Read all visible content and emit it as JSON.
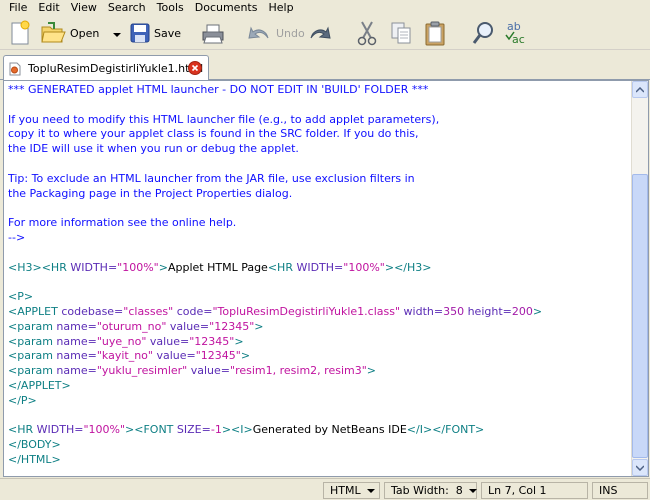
{
  "menu": [
    "File",
    "Edit",
    "View",
    "Search",
    "Tools",
    "Documents",
    "Help"
  ],
  "toolbar": {
    "open_label": "Open",
    "save_label": "Save",
    "undo_label": "Undo"
  },
  "tab": {
    "label": "TopluResimDegistirliYukle1.html"
  },
  "code_lines": [
    [
      {
        "c": "c-comment",
        "t": "*** GENERATED applet HTML launcher - DO NOT EDIT IN 'BUILD' FOLDER ***"
      }
    ],
    [],
    [
      {
        "c": "c-comment",
        "t": "If you need to modify this HTML launcher file (e.g., to add applet parameters),"
      }
    ],
    [
      {
        "c": "c-comment",
        "t": "copy it to where your applet class is found in the SRC folder. If you do this,"
      }
    ],
    [
      {
        "c": "c-comment",
        "t": "the IDE will use it when you run or debug the applet."
      }
    ],
    [],
    [
      {
        "c": "c-comment",
        "t": "Tip: To exclude an HTML launcher from the JAR file, use exclusion filters in"
      }
    ],
    [
      {
        "c": "c-comment",
        "t": "the Packaging page in the Project Properties dialog."
      }
    ],
    [],
    [
      {
        "c": "c-comment",
        "t": "For more information see the online help."
      }
    ],
    [
      {
        "c": "c-comment",
        "t": "-->"
      }
    ],
    [],
    [
      {
        "c": "c-tag",
        "t": "<H3>"
      },
      {
        "c": "c-tag",
        "t": "<HR "
      },
      {
        "c": "c-attr",
        "t": "WIDTH="
      },
      {
        "c": "c-val",
        "t": "\"100%\""
      },
      {
        "c": "c-tag",
        "t": ">"
      },
      {
        "c": "c-text",
        "t": "Applet HTML Page"
      },
      {
        "c": "c-tag",
        "t": "<HR "
      },
      {
        "c": "c-attr",
        "t": "WIDTH="
      },
      {
        "c": "c-val",
        "t": "\"100%\""
      },
      {
        "c": "c-tag",
        "t": ">"
      },
      {
        "c": "c-tag",
        "t": "</H3>"
      }
    ],
    [],
    [
      {
        "c": "c-tag",
        "t": "<P>"
      }
    ],
    [
      {
        "c": "c-tag",
        "t": "<APPLET "
      },
      {
        "c": "c-attr",
        "t": "codebase="
      },
      {
        "c": "c-val",
        "t": "\"classes\""
      },
      {
        "c": "c-attr",
        "t": " code="
      },
      {
        "c": "c-val",
        "t": "\"TopluResimDegistirliYukle1.class\""
      },
      {
        "c": "c-attr",
        "t": " width="
      },
      {
        "c": "c-purple",
        "t": "350"
      },
      {
        "c": "c-attr",
        "t": " height="
      },
      {
        "c": "c-purple",
        "t": "200"
      },
      {
        "c": "c-tag",
        "t": ">"
      }
    ],
    [
      {
        "c": "c-tag",
        "t": "<param "
      },
      {
        "c": "c-attr",
        "t": "name="
      },
      {
        "c": "c-val",
        "t": "\"oturum_no\""
      },
      {
        "c": "c-attr",
        "t": " value="
      },
      {
        "c": "c-val",
        "t": "\"12345\""
      },
      {
        "c": "c-tag",
        "t": ">"
      }
    ],
    [
      {
        "c": "c-tag",
        "t": "<param "
      },
      {
        "c": "c-attr",
        "t": "name="
      },
      {
        "c": "c-val",
        "t": "\"uye_no\""
      },
      {
        "c": "c-attr",
        "t": " value="
      },
      {
        "c": "c-val",
        "t": "\"12345\""
      },
      {
        "c": "c-tag",
        "t": ">"
      }
    ],
    [
      {
        "c": "c-tag",
        "t": "<param "
      },
      {
        "c": "c-attr",
        "t": "name="
      },
      {
        "c": "c-val",
        "t": "\"kayit_no\""
      },
      {
        "c": "c-attr",
        "t": " value="
      },
      {
        "c": "c-val",
        "t": "\"12345\""
      },
      {
        "c": "c-tag",
        "t": ">"
      }
    ],
    [
      {
        "c": "c-tag",
        "t": "<param "
      },
      {
        "c": "c-attr",
        "t": "name="
      },
      {
        "c": "c-val",
        "t": "\"yuklu_resimler\""
      },
      {
        "c": "c-attr",
        "t": " value="
      },
      {
        "c": "c-val",
        "t": "\"resim1, resim2, resim3\""
      },
      {
        "c": "c-tag",
        "t": ">"
      }
    ],
    [
      {
        "c": "c-tag",
        "t": "</APPLET>"
      }
    ],
    [
      {
        "c": "c-tag",
        "t": "</P>"
      }
    ],
    [],
    [
      {
        "c": "c-tag",
        "t": "<HR "
      },
      {
        "c": "c-attr",
        "t": "WIDTH="
      },
      {
        "c": "c-val",
        "t": "\"100%\""
      },
      {
        "c": "c-tag",
        "t": ">"
      },
      {
        "c": "c-tag",
        "t": "<FONT "
      },
      {
        "c": "c-attr",
        "t": "SIZE="
      },
      {
        "c": "c-val",
        "t": "-1"
      },
      {
        "c": "c-tag",
        "t": ">"
      },
      {
        "c": "c-tag",
        "t": "<I>"
      },
      {
        "c": "c-text",
        "t": "Generated by NetBeans IDE"
      },
      {
        "c": "c-tag",
        "t": "</I>"
      },
      {
        "c": "c-tag",
        "t": "</FONT>"
      }
    ],
    [
      {
        "c": "c-tag",
        "t": "</BODY>"
      }
    ],
    [
      {
        "c": "c-tag",
        "t": "</HTML>"
      }
    ]
  ],
  "status": {
    "language": "HTML",
    "tab_width": "Tab Width:  8",
    "position": "Ln 7, Col 1",
    "mode": "INS"
  }
}
